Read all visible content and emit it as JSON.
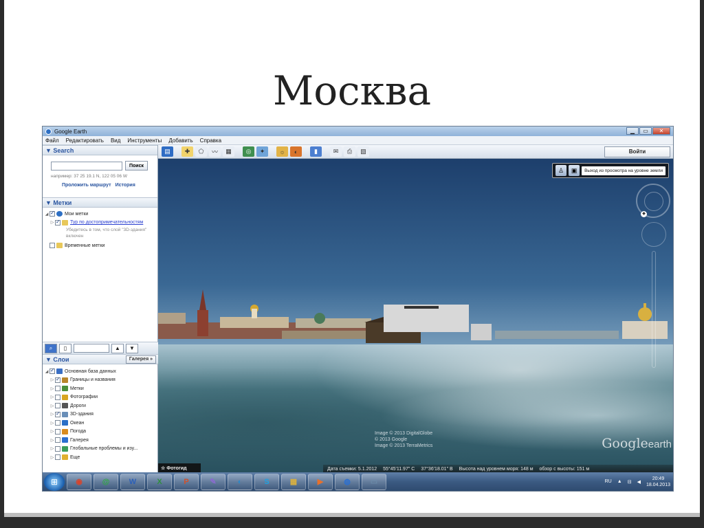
{
  "slide": {
    "title": "Москва"
  },
  "window": {
    "title": "Google Earth",
    "controls": [
      "▁",
      "▭",
      "✕"
    ]
  },
  "menu": [
    "Файл",
    "Редактировать",
    "Вид",
    "Инструменты",
    "Добавить",
    "Справка"
  ],
  "search": {
    "header": "▼ Search",
    "button": "Поиск",
    "hint": "например: 37 25 19.1 N, 122 05 06 W",
    "route_link": "Проложить маршрут",
    "history_link": "История"
  },
  "places": {
    "header": "▼ Метки",
    "my_places": "Мои метки",
    "tour": "Тур по достопримечательностям",
    "note": "Убедитесь в том, что слой \"3D-здания\" включен",
    "temp": "Временные метки"
  },
  "layers": {
    "header": "▼ Слои",
    "gallery_button": "Галерея »",
    "items": [
      {
        "label": "Основная база данных",
        "checked": true,
        "color": "#3a6fc4"
      },
      {
        "label": "Границы и названия",
        "checked": true,
        "color": "#b8862b"
      },
      {
        "label": "Метки",
        "checked": false,
        "color": "#4a8f3a"
      },
      {
        "label": "Фотографии",
        "checked": false,
        "color": "#d8a520"
      },
      {
        "label": "Дороги",
        "checked": false,
        "color": "#555555"
      },
      {
        "label": "3D-здания",
        "checked": true,
        "color": "#6a8fb8"
      },
      {
        "label": "Океан",
        "checked": false,
        "color": "#2a6fc7"
      },
      {
        "label": "Погода",
        "checked": false,
        "color": "#d88b20"
      },
      {
        "label": "Галерея",
        "checked": false,
        "color": "#2b6fd0"
      },
      {
        "label": "Глобальные проблемы и изу...",
        "checked": false,
        "color": "#3b9c5a"
      },
      {
        "label": "Еще",
        "checked": false,
        "color": "#e0b030"
      }
    ]
  },
  "toolbar": {
    "login": "Войти",
    "icons": [
      "sidebar-icon",
      "placemark-icon",
      "polygon-icon",
      "path-icon",
      "overlay-icon",
      "tour-icon",
      "sky-icon",
      "sun-icon",
      "mars-icon",
      "ruler-icon",
      "email-icon",
      "print-icon",
      "maps-icon"
    ]
  },
  "viewport": {
    "exit_ground_label": "Выход из просмотра на уровне земли",
    "imagery_lines": [
      "Image © 2013 DigitalGlobe",
      "© 2013 Google",
      "Image © 2013 TerraMetrics"
    ],
    "logo_main": "Google",
    "logo_sub": "earth",
    "photoguide": "☆ Фотогид",
    "status": {
      "date": "Дата съемки: 5.1.2012",
      "lat": "55°45'11.97\" С",
      "lon": "37°36'18.01\" В",
      "elevation": "Высота над уровнем моря: 148 м",
      "eye": "обзор с высоты: 151 м"
    }
  },
  "taskbar": {
    "apps": [
      "◉",
      "@",
      "W",
      "X",
      "P",
      "✎",
      "◐",
      "S",
      "▦",
      "▶",
      "◍",
      "▭"
    ],
    "lang": "RU",
    "time": "20:49",
    "date": "18.04.2013"
  },
  "colors": {
    "accent": "#2a55a0",
    "sky_top": "#1d3f6c",
    "taskbar": "#3b5a82"
  }
}
